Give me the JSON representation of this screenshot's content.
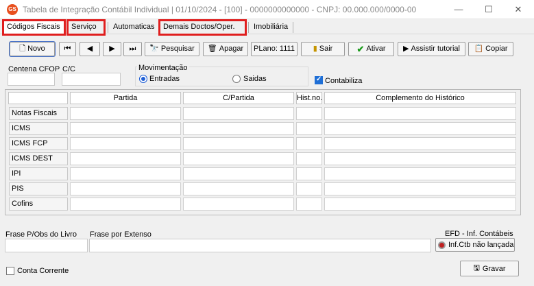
{
  "window": {
    "title": "Tabela de Integração Contábil Individual  |  01/10/2024 - [100] - 0000000000000 - CNPJ: 00.000.000/0000-00",
    "app_icon_text": "GS",
    "minimize": "—",
    "maximize": "☐",
    "close": "✕"
  },
  "tabs": [
    "Códigos Fiscais",
    "Serviço",
    "Automaticas",
    "Demais Doctos/Oper.",
    "Imobiliária"
  ],
  "toolbar": {
    "novo": "Novo",
    "first": "⏮",
    "prev": "◀",
    "next": "▶",
    "last": "⏭",
    "pesquisar": "Pesquisar",
    "apagar": "Apagar",
    "plano": "PLano: 1111",
    "sair": "Sair",
    "ativar": "Ativar",
    "assistir": "Assistir tutorial",
    "copiar": "Copiar"
  },
  "filters": {
    "centena_label": "Centena CFOP",
    "cc_label": "C/C",
    "centena_value": "",
    "cc_value": "",
    "movimentacao_label": "Movimentação",
    "entradas": "Entradas",
    "saidas": "Saidas",
    "contabiliza": "Contabiliza"
  },
  "grid": {
    "columns": [
      "Partida",
      "C/Partida",
      "Hist.no.",
      "Complemento do Histórico"
    ],
    "rows": [
      "Notas Fiscais",
      "ICMS",
      "ICMS FCP",
      "ICMS DEST",
      "IPI",
      "PIS",
      "Cofins"
    ]
  },
  "bottom": {
    "frase_livro_label": "Frase P/Obs do Livro",
    "frase_extenso_label": "Frase por Extenso",
    "efd_label": "EFD - Inf. Contábeis",
    "inf_ctb": "Inf.Ctb não lançada",
    "conta_corrente": "Conta Corrente",
    "gravar": "Gravar"
  },
  "colors": {
    "highlight": "#e01e1e",
    "accent": "#1f5fd6"
  }
}
